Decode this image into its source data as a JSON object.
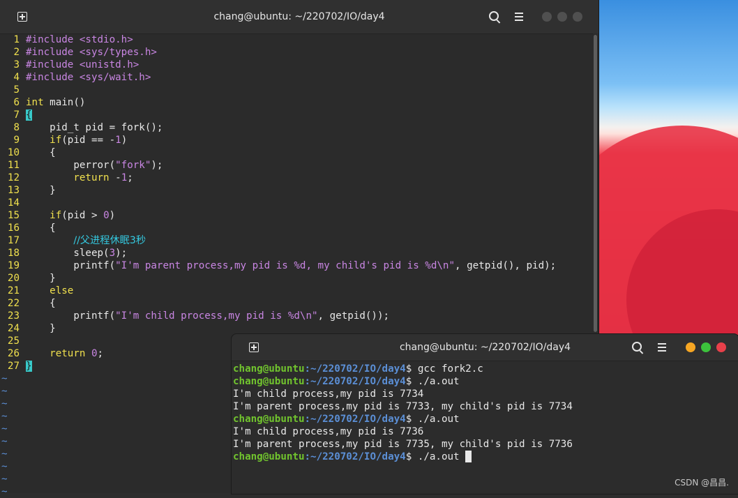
{
  "vim_window": {
    "title": "chang@ubuntu: ~/220702/IO/day4",
    "icons": [
      "new-tab-icon",
      "search-icon",
      "hamburger-menu-icon"
    ],
    "code_lines": [
      {
        "n": "1",
        "text": "#include <stdio.h>"
      },
      {
        "n": "2",
        "text": "#include <sys/types.h>"
      },
      {
        "n": "3",
        "text": "#include <unistd.h>"
      },
      {
        "n": "4",
        "text": "#include <sys/wait.h>"
      },
      {
        "n": "5",
        "text": ""
      },
      {
        "n": "6",
        "text": "int main()"
      },
      {
        "n": "7",
        "text": "{"
      },
      {
        "n": "8",
        "text": "    pid_t pid = fork();"
      },
      {
        "n": "9",
        "text": "    if(pid == -1)"
      },
      {
        "n": "10",
        "text": "    {"
      },
      {
        "n": "11",
        "text": "        perror(\"fork\");"
      },
      {
        "n": "12",
        "text": "        return -1;"
      },
      {
        "n": "13",
        "text": "    }"
      },
      {
        "n": "14",
        "text": ""
      },
      {
        "n": "15",
        "text": "    if(pid > 0)"
      },
      {
        "n": "16",
        "text": "    {"
      },
      {
        "n": "17",
        "text": "        //父进程休眠3秒"
      },
      {
        "n": "18",
        "text": "        sleep(3);"
      },
      {
        "n": "19",
        "text": "        printf(\"I'm parent process,my pid is %d, my child's pid is %d\\n\", getpid(), pid);"
      },
      {
        "n": "20",
        "text": "    }"
      },
      {
        "n": "21",
        "text": "    else"
      },
      {
        "n": "22",
        "text": "    {"
      },
      {
        "n": "23",
        "text": "        printf(\"I'm child process,my pid is %d\\n\", getpid());"
      },
      {
        "n": "24",
        "text": "    }"
      },
      {
        "n": "25",
        "text": ""
      },
      {
        "n": "26",
        "text": "    return 0;"
      },
      {
        "n": "27",
        "text": "}"
      }
    ],
    "tilde": "~",
    "tilde_count": 10
  },
  "terminal_window": {
    "title": "chang@ubuntu: ~/220702/IO/day4",
    "icons": [
      "new-tab-icon",
      "search-icon",
      "hamburger-menu-icon"
    ],
    "window_buttons": {
      "minimize_color": "#f6a623",
      "maximize_color": "#3cc23c",
      "close_color": "#e8404a"
    },
    "prompt_user": "chang@ubuntu",
    "prompt_path": ":~/220702/IO/day4",
    "prompt_symbol": "$ ",
    "lines": [
      {
        "kind": "prompt",
        "cmd": "gcc fork2.c"
      },
      {
        "kind": "prompt",
        "cmd": "./a.out"
      },
      {
        "kind": "out",
        "text": "I'm child process,my pid is 7734"
      },
      {
        "kind": "out",
        "text": "I'm parent process,my pid is 7733, my child's pid is 7734"
      },
      {
        "kind": "prompt",
        "cmd": "./a.out"
      },
      {
        "kind": "out",
        "text": "I'm child process,my pid is 7736"
      },
      {
        "kind": "out",
        "text": "I'm parent process,my pid is 7735, my child's pid is 7736"
      },
      {
        "kind": "prompt",
        "cmd": "./a.out ",
        "cursor": true
      }
    ]
  },
  "watermark": "CSDN @昌昌.",
  "colors": {
    "line_number": "#f0e04e",
    "preprocessor": "#c986e3",
    "keyword": "#f0e04e",
    "comment": "#34c9e0",
    "prompt_user": "#71c42e",
    "prompt_path": "#5b8fd6"
  }
}
